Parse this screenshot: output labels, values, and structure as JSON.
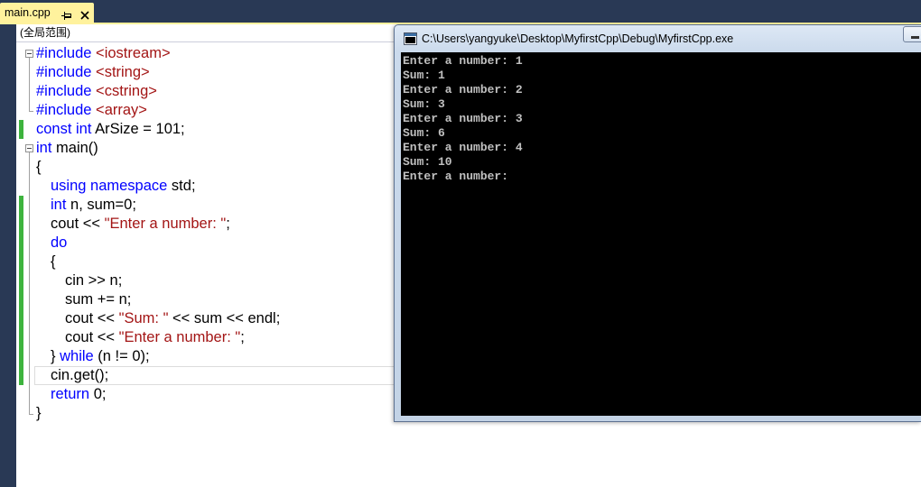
{
  "document_tab": {
    "label": "main.cpp"
  },
  "navigation_bar": {
    "scope": "(全局范围)"
  },
  "editor": {
    "lines": [
      {
        "fold_start": true,
        "tokens": [
          {
            "t": "#include",
            "color": "#0000ff"
          },
          {
            "t": " <iostream>",
            "color": "#a31515"
          }
        ]
      },
      {
        "in_fold": true,
        "tokens": [
          {
            "t": "#include",
            "color": "#0000ff"
          },
          {
            "t": " <string>",
            "color": "#a31515"
          }
        ]
      },
      {
        "in_fold": true,
        "tokens": [
          {
            "t": "#include",
            "color": "#0000ff"
          },
          {
            "t": " <cstring>",
            "color": "#a31515"
          }
        ]
      },
      {
        "fold_end": true,
        "tokens": [
          {
            "t": "#include",
            "color": "#0000ff"
          },
          {
            "t": " <array>",
            "color": "#a31515"
          }
        ]
      },
      {
        "changed": true,
        "tokens": [
          {
            "t": "const int",
            "color": "#0000ff"
          },
          {
            "t": " ArSize = 101;",
            "color": "#000000"
          }
        ]
      },
      {
        "fold_start": true,
        "tokens": [
          {
            "t": "int",
            "color": "#0000ff"
          },
          {
            "t": " main()",
            "color": "#000000"
          }
        ]
      },
      {
        "in_fold": true,
        "tokens": [
          {
            "t": "{",
            "color": "#000000"
          }
        ]
      },
      {
        "in_fold": true,
        "tokens": [
          {
            "t": "\tusing namespace",
            "color": "#0000ff"
          },
          {
            "t": " std;",
            "color": "#000000"
          }
        ]
      },
      {
        "in_fold": true,
        "changed": true,
        "tokens": [
          {
            "t": "\tint",
            "color": "#0000ff"
          },
          {
            "t": " n, sum=0;",
            "color": "#000000"
          }
        ]
      },
      {
        "in_fold": true,
        "changed": true,
        "tokens": [
          {
            "t": "\tcout << ",
            "color": "#000000"
          },
          {
            "t": "\"Enter a number: \"",
            "color": "#a31515"
          },
          {
            "t": ";",
            "color": "#000000"
          }
        ]
      },
      {
        "in_fold": true,
        "changed": true,
        "tokens": [
          {
            "t": "\tdo",
            "color": "#0000ff"
          }
        ]
      },
      {
        "in_fold": true,
        "changed": true,
        "tokens": [
          {
            "t": "\t{",
            "color": "#000000"
          }
        ]
      },
      {
        "in_fold": true,
        "changed": true,
        "tokens": [
          {
            "t": "\t\tcin >> n;",
            "color": "#000000"
          }
        ]
      },
      {
        "in_fold": true,
        "changed": true,
        "tokens": [
          {
            "t": "\t\tsum += n;",
            "color": "#000000"
          }
        ]
      },
      {
        "in_fold": true,
        "changed": true,
        "tokens": [
          {
            "t": "\t\tcout << ",
            "color": "#000000"
          },
          {
            "t": "\"Sum: \"",
            "color": "#a31515"
          },
          {
            "t": " << sum << endl;",
            "color": "#000000"
          }
        ]
      },
      {
        "in_fold": true,
        "changed": true,
        "tokens": [
          {
            "t": "\t\tcout << ",
            "color": "#000000"
          },
          {
            "t": "\"Enter a number: \"",
            "color": "#a31515"
          },
          {
            "t": ";",
            "color": "#000000"
          }
        ]
      },
      {
        "in_fold": true,
        "changed": true,
        "tokens": [
          {
            "t": "\t} ",
            "color": "#000000"
          },
          {
            "t": "while",
            "color": "#0000ff"
          },
          {
            "t": " (n != 0);",
            "color": "#000000"
          }
        ]
      },
      {
        "in_fold": true,
        "changed": true,
        "current": true,
        "tokens": [
          {
            "t": "\tcin.get();",
            "color": "#000000"
          }
        ]
      },
      {
        "in_fold": true,
        "tokens": [
          {
            "t": "\treturn",
            "color": "#0000ff"
          },
          {
            "t": " 0;",
            "color": "#000000"
          }
        ]
      },
      {
        "fold_end": true,
        "tokens": [
          {
            "t": "}",
            "color": "#000000"
          }
        ]
      }
    ]
  },
  "console": {
    "title": "C:\\Users\\yangyuke\\Desktop\\MyfirstCpp\\Debug\\MyfirstCpp.exe",
    "lines": [
      "Enter a number: 1",
      "Sum: 1",
      "Enter a number: 2",
      "Sum: 3",
      "Enter a number: 3",
      "Sum: 6",
      "Enter a number: 4",
      "Sum: 10",
      "Enter a number:"
    ]
  },
  "icons": {
    "tab_pin": "pin-icon",
    "tab_close": "close-icon",
    "console_app": "console-app-icon",
    "minimize": "minimize-icon",
    "collapse": "collapse-icon"
  },
  "colors": {
    "frame": "#293955",
    "active_tab": "#fff29d",
    "keyword": "#0000ff",
    "string": "#a31515",
    "text": "#000000",
    "change_marker": "#3db33d",
    "console_background": "#000000",
    "console_text": "#c0c0c0"
  }
}
